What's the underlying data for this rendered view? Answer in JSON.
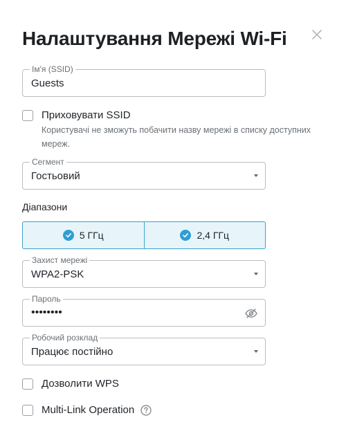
{
  "dialog": {
    "title": "Налаштування Мережі Wi-Fi"
  },
  "ssid": {
    "label": "Ім'я (SSID)",
    "value": "Guests"
  },
  "hide_ssid": {
    "label": "Приховувати SSID",
    "checked": false,
    "help": "Користувачі не зможуть побачити назву мережі в списку доступних мереж."
  },
  "segment": {
    "label": "Сегмент",
    "value": "Гостьовий"
  },
  "bands": {
    "label": "Діапазони",
    "items": [
      {
        "label": "5 ГГц",
        "checked": true
      },
      {
        "label": "2,4 ГГц",
        "checked": true
      }
    ]
  },
  "security": {
    "label": "Захист мережі",
    "value": "WPA2-PSK"
  },
  "password": {
    "label": "Пароль",
    "masked_value": "••••••••"
  },
  "schedule": {
    "label": "Робочий розклад",
    "value": "Працює постійно"
  },
  "wps": {
    "label": "Дозволити WPS",
    "checked": false
  },
  "mlo": {
    "label": "Multi-Link Operation",
    "checked": false
  },
  "colors": {
    "accent": "#2e9fd2",
    "band_bg": "#e7f5fb",
    "border": "#b9bdc2"
  },
  "icons": {
    "close": "close-icon",
    "eye_off": "eye-off-icon",
    "dropdown": "chevron-down-icon",
    "help": "question-icon",
    "check": "check-circle-icon"
  }
}
